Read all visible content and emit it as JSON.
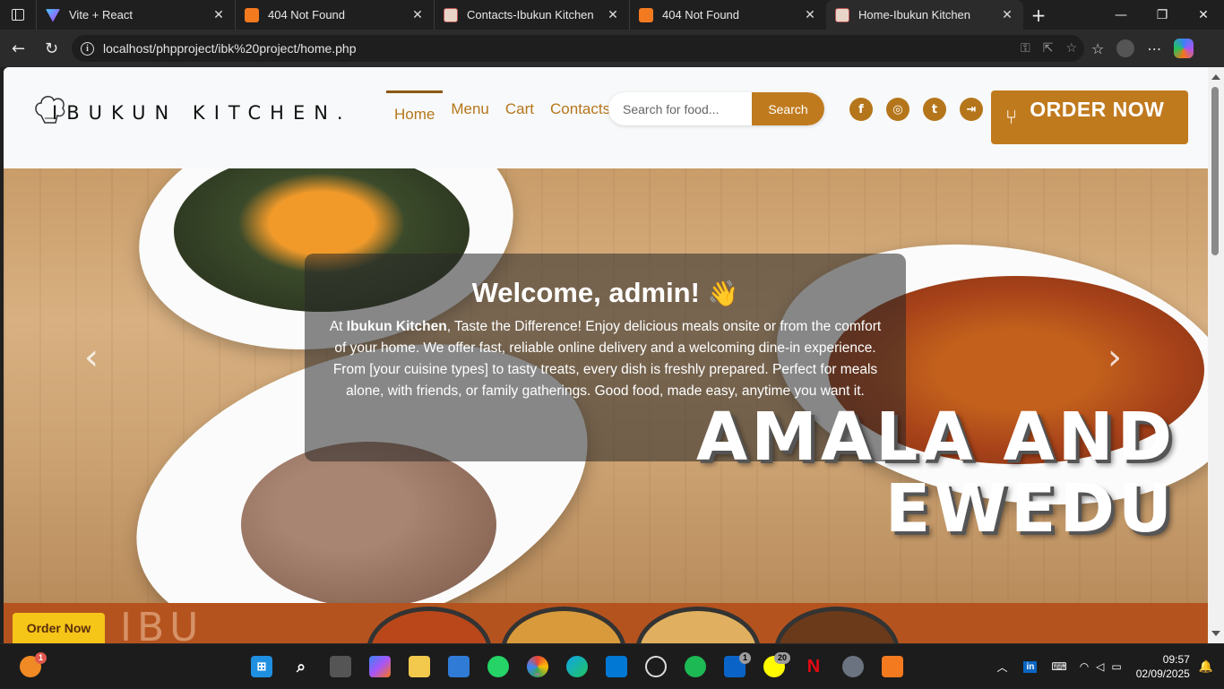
{
  "browser": {
    "tabs": [
      {
        "title": "Vite + React",
        "icon": "vite-icon",
        "active": false
      },
      {
        "title": "404 Not Found",
        "icon": "xampp-icon",
        "active": false
      },
      {
        "title": "Contacts-Ibukun Kitchen",
        "icon": "ibukun-favicon",
        "active": false
      },
      {
        "title": "404 Not Found",
        "icon": "xampp-icon",
        "active": false
      },
      {
        "title": "Home-Ibukun Kitchen",
        "icon": "ibukun-favicon",
        "active": true
      }
    ],
    "url": "localhost/phpproject/ibk%20project/home.php"
  },
  "site": {
    "brand": "IBUKUN KITCHEN.",
    "nav": [
      {
        "label": "Home",
        "active": true
      },
      {
        "label": "Menu",
        "active": false
      },
      {
        "label": "Cart",
        "active": false
      },
      {
        "label": "Contacts",
        "active": false
      }
    ],
    "search": {
      "placeholder": "Search for food...",
      "button": "Search"
    },
    "social_icons": [
      "facebook-icon",
      "instagram-icon",
      "twitter-icon",
      "logout-icon"
    ],
    "order_button": "ORDER NOW",
    "hero": {
      "greeting": "Welcome, admin!",
      "wave": "👋",
      "intro_prefix": "At ",
      "intro_brand": "Ibukun Kitchen",
      "intro_text": ", Taste the Difference! Enjoy delicious meals onsite or from the comfort of your home. We offer fast, reliable online delivery and a welcoming dine-in experience. From [your cuisine types] to tasty treats, every dish is freshly prepared. Perfect for meals alone, with friends, or family gatherings. Good food, made easy, anytime you want it.",
      "dish_line1": "AMALA AND",
      "dish_line2": "EWEDU"
    },
    "banner": {
      "order_button": "Order Now",
      "ghost_text": "IBU"
    }
  },
  "taskbar": {
    "apps": [
      "start-icon",
      "search-icon",
      "task-view-icon",
      "copilot-icon",
      "file-explorer-icon",
      "store-icon",
      "whatsapp-icon",
      "chrome-icon",
      "edge-icon",
      "vscode-icon",
      "chatgpt-icon",
      "spotify-icon",
      "outlook-icon",
      "snapchat-icon",
      "netflix-icon",
      "settings-icon",
      "xampp-icon"
    ],
    "badges": {
      "weather": "1",
      "outlook": "1",
      "snapchat": "20"
    },
    "time": "09:57",
    "date": "02/09/2025"
  },
  "colors": {
    "accent": "#c07a1e",
    "nav_text": "#b5761b",
    "banner": "#b5531e"
  }
}
